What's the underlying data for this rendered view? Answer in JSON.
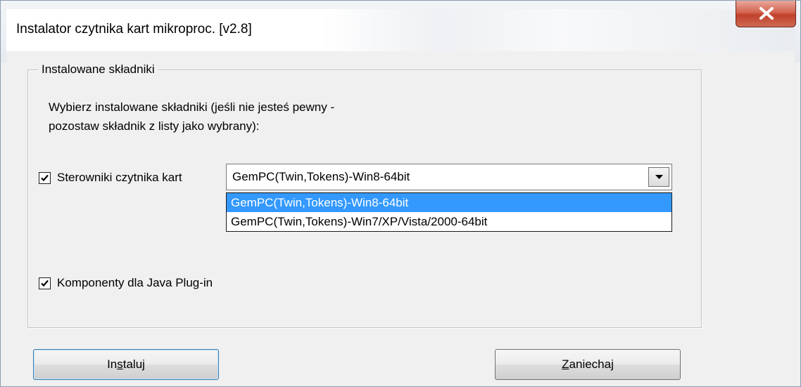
{
  "window": {
    "title": "Instalator czytnika kart mikroproc. [v2.8]",
    "close_icon": "close-icon"
  },
  "group": {
    "legend": "Instalowane składniki",
    "description_line1": "Wybierz instalowane składniki (jeśli nie jesteś pewny -",
    "description_line2": "pozostaw składnik z listy jako wybrany):"
  },
  "drivers": {
    "label": "Sterowniki czytnika kart",
    "checked": true,
    "selected_value": "GemPC(Twin,Tokens)-Win8-64bit",
    "options": [
      "GemPC(Twin,Tokens)-Win8-64bit",
      "GemPC(Twin,Tokens)-Win7/XP/Vista/2000-64bit"
    ]
  },
  "java": {
    "label": "Komponenty dla Java Plug-in",
    "checked": true
  },
  "buttons": {
    "install_pre": "In",
    "install_accel": "s",
    "install_post": "taluj",
    "cancel_accel": "Z",
    "cancel_post": "aniechaj"
  },
  "colors": {
    "selection": "#3399ff",
    "close_button": "#c0412c"
  }
}
